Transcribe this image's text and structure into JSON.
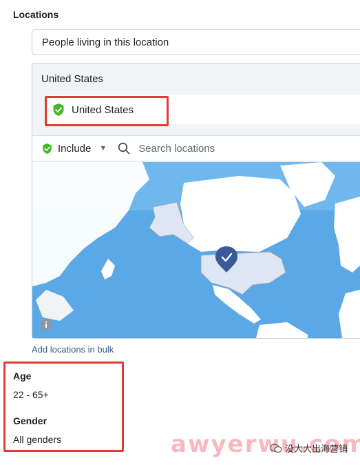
{
  "locations": {
    "section_label": "Locations",
    "audience_type": "People living in this location",
    "group_title": "United States",
    "selected": [
      {
        "name": "United States",
        "status": "included",
        "icon": "green-check-shield-icon"
      }
    ],
    "filter_mode": "Include",
    "search_placeholder": "Search locations",
    "bulk_link": "Add locations in bulk"
  },
  "age": {
    "label": "Age",
    "value": "22 - 65+"
  },
  "gender": {
    "label": "Gender",
    "value": "All genders"
  },
  "watermark": {
    "text": "awyerwu.com",
    "badge": "没大大出海营销"
  },
  "colors": {
    "include_green": "#42b72a",
    "highlight_red": "#e53935",
    "link_blue": "#385898",
    "ocean": "#5aa9e6",
    "land": "#ffffff",
    "selected_country": "#dfe6f3",
    "pin": "#3b5998"
  }
}
